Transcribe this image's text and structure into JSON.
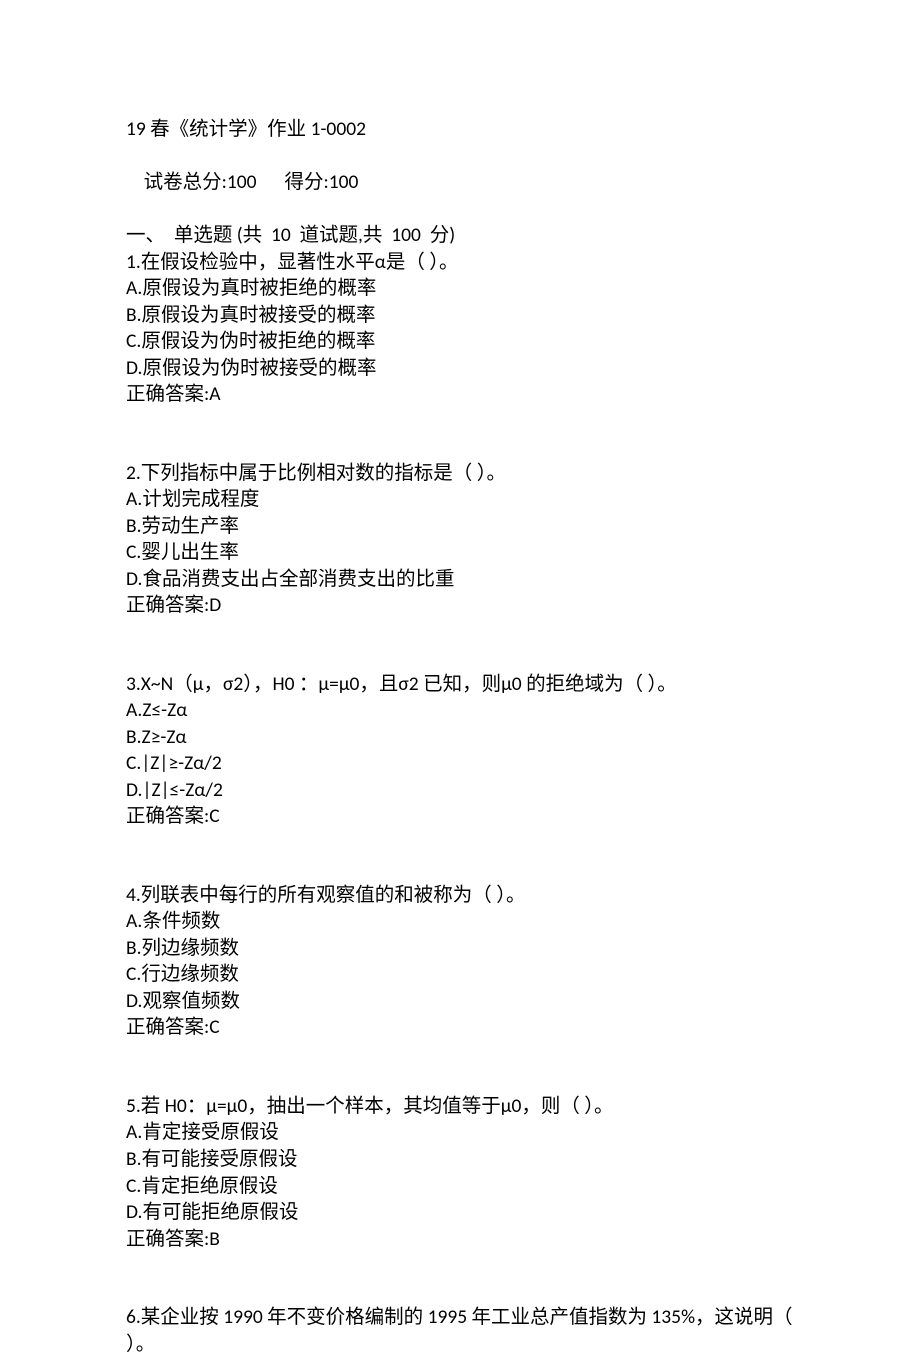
{
  "header": {
    "title": "19 春《统计学》作业 1-0002",
    "total_label": "试卷总分:100",
    "score_label": "得分:100",
    "section_label": "一、  单选题 (共  10  道试题,共  100  分)"
  },
  "questions": [
    {
      "stem": "1.在假设检验中，显著性水平α是（ ）。",
      "options": [
        "A.原假设为真时被拒绝的概率",
        "B.原假设为真时被接受的概率",
        "C.原假设为伪时被拒绝的概率",
        "D.原假设为伪时被接受的概率"
      ],
      "answer": "正确答案:A"
    },
    {
      "stem": "2.下列指标中属于比例相对数的指标是（ ）。",
      "options": [
        "A.计划完成程度",
        "B.劳动生产率",
        "C.婴儿出生率",
        "D.食品消费支出占全部消费支出的比重"
      ],
      "answer": "正确答案:D"
    },
    {
      "stem": "3.X~N（μ，σ2），H0 ：μ=μ0，且σ2 已知，则μ0 的拒绝域为（ ）。",
      "options": [
        "A.Z≤-Zα",
        "B.Z≥-Zα",
        "C.|Z|≥-Zα/2",
        "D.|Z|≤-Zα/2"
      ],
      "answer": "正确答案:C"
    },
    {
      "stem": "4.列联表中每行的所有观察值的和被称为（ ）。",
      "options": [
        "A.条件频数",
        "B.列边缘频数",
        "C.行边缘频数",
        "D.观察值频数"
      ],
      "answer": "正确答案:C"
    },
    {
      "stem": "5.若 H0：μ=μ0，抽出一个样本，其均值等于μ0，则（ ）。",
      "options": [
        "A.肯定接受原假设",
        "B.有可能接受原假设",
        "C.肯定拒绝原假设",
        "D.有可能拒绝原假设"
      ],
      "answer": "正确答案:B"
    },
    {
      "stem": "6.某企业按 1990 年不变价格编制的 1995 年工业总产值指数为 135%，这说明（ ）。",
      "options": [],
      "answer": ""
    }
  ]
}
